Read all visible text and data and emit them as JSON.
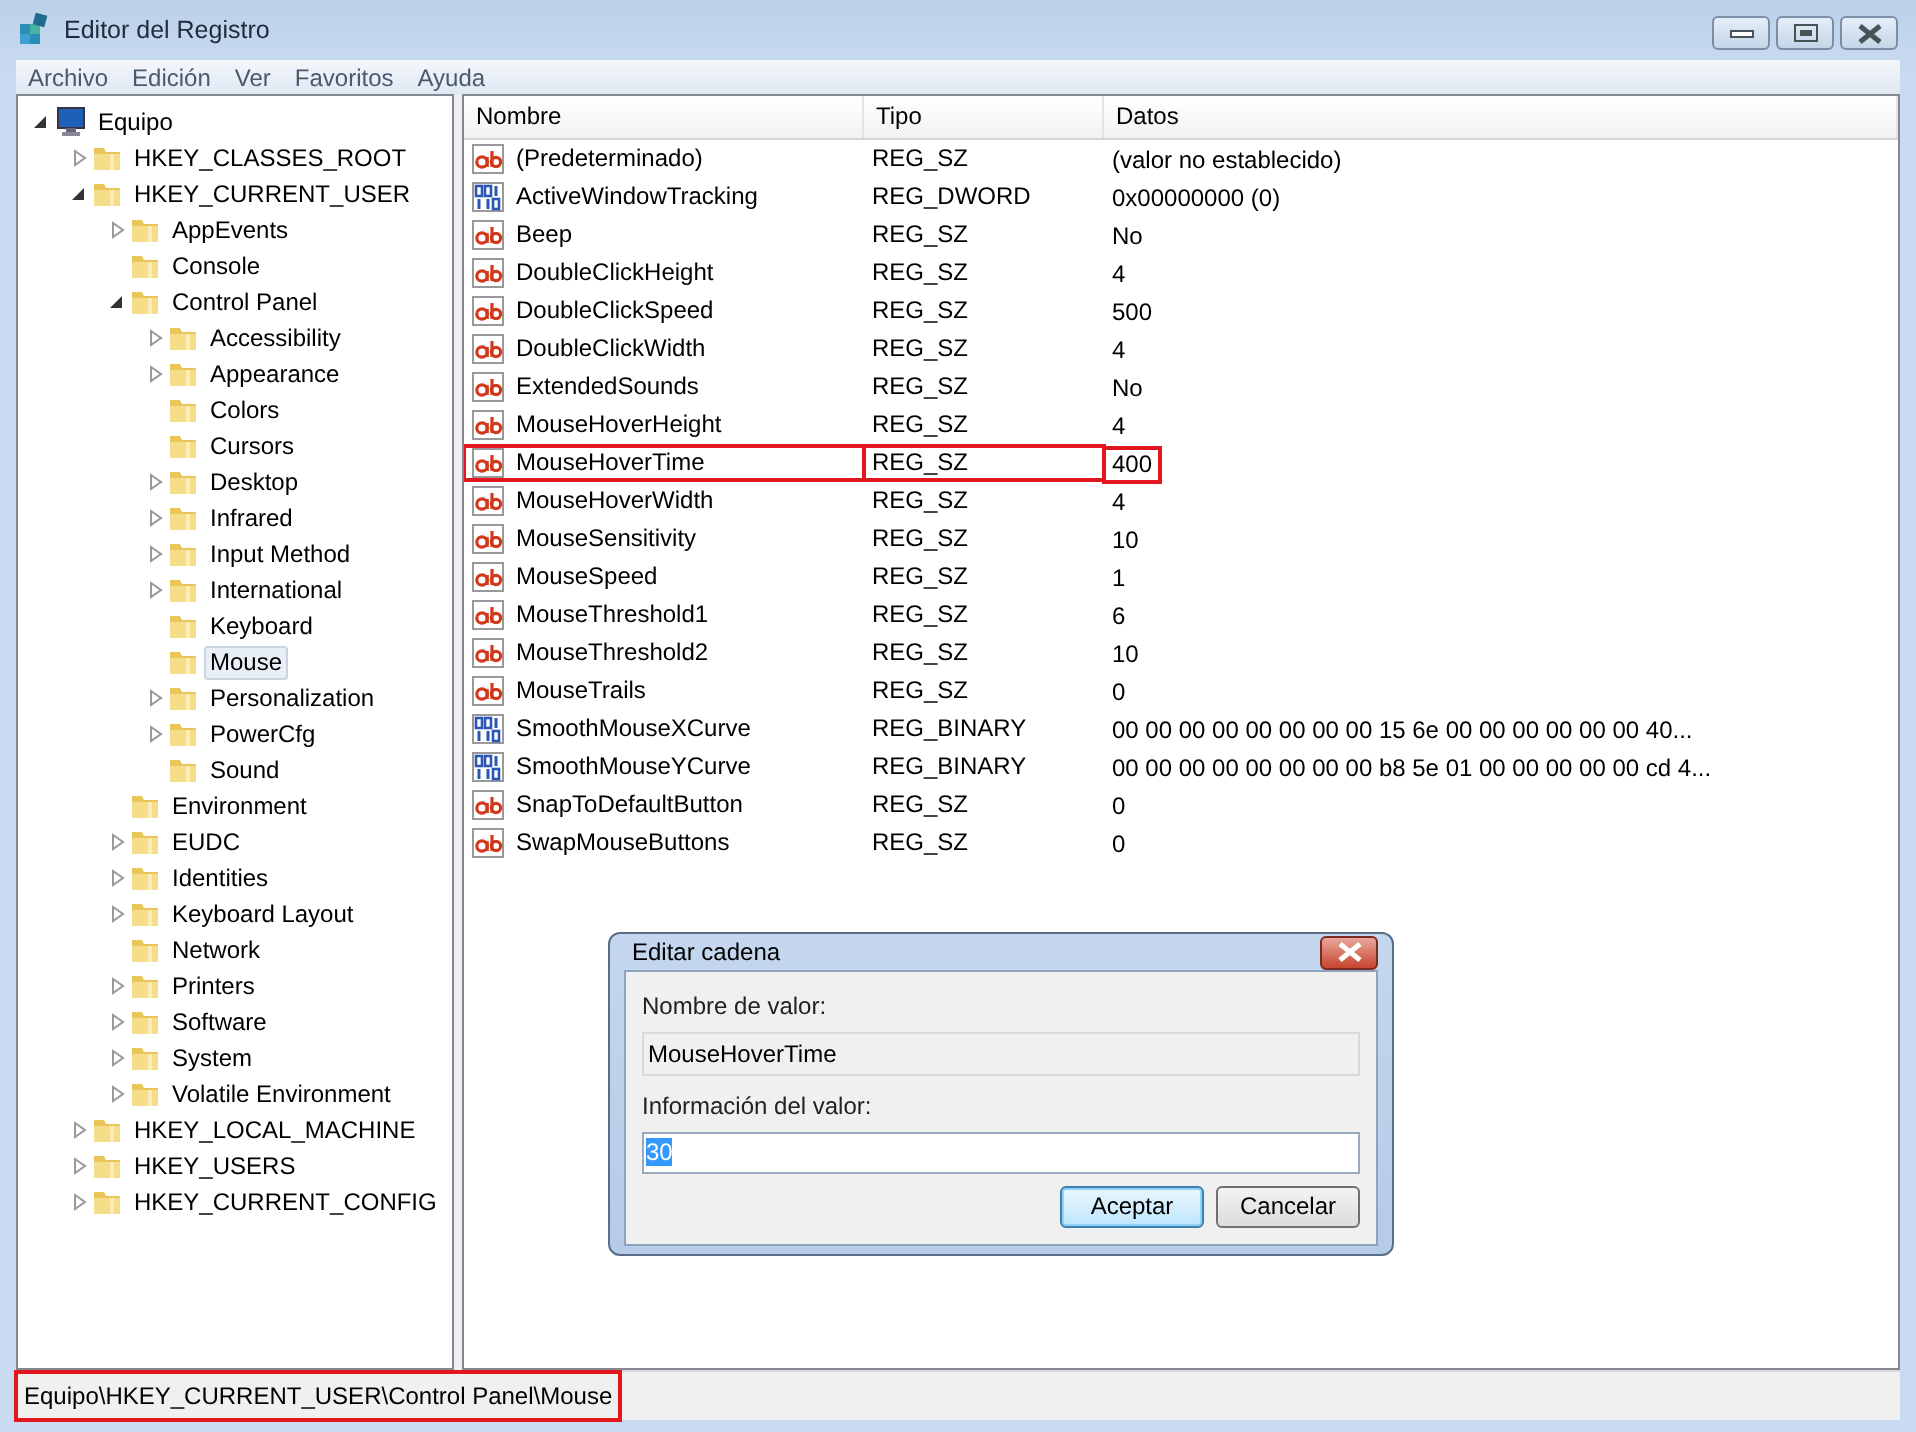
{
  "window": {
    "title": "Editor del Registro"
  },
  "menu": [
    "Archivo",
    "Edición",
    "Ver",
    "Favoritos",
    "Ayuda"
  ],
  "tree": [
    {
      "label": "Equipo",
      "kind": "computer",
      "expanded": true,
      "selected": false,
      "children": [
        {
          "label": "HKEY_CLASSES_ROOT",
          "kind": "branch",
          "expanded": false,
          "selected": false
        },
        {
          "label": "HKEY_CURRENT_USER",
          "kind": "branch",
          "expanded": true,
          "selected": false,
          "children": [
            {
              "label": "AppEvents",
              "kind": "branch",
              "expanded": false,
              "selected": false
            },
            {
              "label": "Console",
              "kind": "leaf",
              "selected": false
            },
            {
              "label": "Control Panel",
              "kind": "branch",
              "expanded": true,
              "selected": false,
              "children": [
                {
                  "label": "Accessibility",
                  "kind": "branch",
                  "expanded": false,
                  "selected": false
                },
                {
                  "label": "Appearance",
                  "kind": "branch",
                  "expanded": false,
                  "selected": false
                },
                {
                  "label": "Colors",
                  "kind": "leaf",
                  "selected": false
                },
                {
                  "label": "Cursors",
                  "kind": "leaf",
                  "selected": false
                },
                {
                  "label": "Desktop",
                  "kind": "branch",
                  "expanded": false,
                  "selected": false
                },
                {
                  "label": "Infrared",
                  "kind": "branch",
                  "expanded": false,
                  "selected": false
                },
                {
                  "label": "Input Method",
                  "kind": "branch",
                  "expanded": false,
                  "selected": false
                },
                {
                  "label": "International",
                  "kind": "branch",
                  "expanded": false,
                  "selected": false
                },
                {
                  "label": "Keyboard",
                  "kind": "leaf",
                  "selected": false
                },
                {
                  "label": "Mouse",
                  "kind": "leaf",
                  "selected": true
                },
                {
                  "label": "Personalization",
                  "kind": "branch",
                  "expanded": false,
                  "selected": false
                },
                {
                  "label": "PowerCfg",
                  "kind": "branch",
                  "expanded": false,
                  "selected": false
                },
                {
                  "label": "Sound",
                  "kind": "leaf",
                  "selected": false
                }
              ]
            },
            {
              "label": "Environment",
              "kind": "leaf",
              "selected": false
            },
            {
              "label": "EUDC",
              "kind": "branch",
              "expanded": false,
              "selected": false
            },
            {
              "label": "Identities",
              "kind": "branch",
              "expanded": false,
              "selected": false
            },
            {
              "label": "Keyboard Layout",
              "kind": "branch",
              "expanded": false,
              "selected": false
            },
            {
              "label": "Network",
              "kind": "leaf",
              "selected": false
            },
            {
              "label": "Printers",
              "kind": "branch",
              "expanded": false,
              "selected": false
            },
            {
              "label": "Software",
              "kind": "branch",
              "expanded": false,
              "selected": false
            },
            {
              "label": "System",
              "kind": "branch",
              "expanded": false,
              "selected": false
            },
            {
              "label": "Volatile Environment",
              "kind": "branch",
              "expanded": false,
              "selected": false
            }
          ]
        },
        {
          "label": "HKEY_LOCAL_MACHINE",
          "kind": "branch",
          "expanded": false,
          "selected": false
        },
        {
          "label": "HKEY_USERS",
          "kind": "branch",
          "expanded": false,
          "selected": false
        },
        {
          "label": "HKEY_CURRENT_CONFIG",
          "kind": "branch",
          "expanded": false,
          "selected": false
        }
      ]
    }
  ],
  "table": {
    "columns": [
      "Nombre",
      "Tipo",
      "Datos"
    ],
    "rows": [
      {
        "kind": "string",
        "name": "(Predeterminado)",
        "type": "REG_SZ",
        "data": "(valor no establecido)",
        "highlighted": false
      },
      {
        "kind": "binary",
        "name": "ActiveWindowTracking",
        "type": "REG_DWORD",
        "data": "0x00000000 (0)",
        "highlighted": false
      },
      {
        "kind": "string",
        "name": "Beep",
        "type": "REG_SZ",
        "data": "No",
        "highlighted": false
      },
      {
        "kind": "string",
        "name": "DoubleClickHeight",
        "type": "REG_SZ",
        "data": "4",
        "highlighted": false
      },
      {
        "kind": "string",
        "name": "DoubleClickSpeed",
        "type": "REG_SZ",
        "data": "500",
        "highlighted": false
      },
      {
        "kind": "string",
        "name": "DoubleClickWidth",
        "type": "REG_SZ",
        "data": "4",
        "highlighted": false
      },
      {
        "kind": "string",
        "name": "ExtendedSounds",
        "type": "REG_SZ",
        "data": "No",
        "highlighted": false
      },
      {
        "kind": "string",
        "name": "MouseHoverHeight",
        "type": "REG_SZ",
        "data": "4",
        "highlighted": false
      },
      {
        "kind": "string",
        "name": "MouseHoverTime",
        "type": "REG_SZ",
        "data": "400",
        "highlighted": true
      },
      {
        "kind": "string",
        "name": "MouseHoverWidth",
        "type": "REG_SZ",
        "data": "4",
        "highlighted": false
      },
      {
        "kind": "string",
        "name": "MouseSensitivity",
        "type": "REG_SZ",
        "data": "10",
        "highlighted": false
      },
      {
        "kind": "string",
        "name": "MouseSpeed",
        "type": "REG_SZ",
        "data": "1",
        "highlighted": false
      },
      {
        "kind": "string",
        "name": "MouseThreshold1",
        "type": "REG_SZ",
        "data": "6",
        "highlighted": false
      },
      {
        "kind": "string",
        "name": "MouseThreshold2",
        "type": "REG_SZ",
        "data": "10",
        "highlighted": false
      },
      {
        "kind": "string",
        "name": "MouseTrails",
        "type": "REG_SZ",
        "data": "0",
        "highlighted": false
      },
      {
        "kind": "binary",
        "name": "SmoothMouseXCurve",
        "type": "REG_BINARY",
        "data": "00 00 00 00 00 00 00 00 15 6e 00 00 00 00 00 00 40...",
        "highlighted": false
      },
      {
        "kind": "binary",
        "name": "SmoothMouseYCurve",
        "type": "REG_BINARY",
        "data": "00 00 00 00 00 00 00 00 b8 5e 01 00 00 00 00 00 cd 4...",
        "highlighted": false
      },
      {
        "kind": "string",
        "name": "SnapToDefaultButton",
        "type": "REG_SZ",
        "data": "0",
        "highlighted": false
      },
      {
        "kind": "string",
        "name": "SwapMouseButtons",
        "type": "REG_SZ",
        "data": "0",
        "highlighted": false
      }
    ]
  },
  "dialog": {
    "title": "Editar cadena",
    "name_label": "Nombre de valor:",
    "name_value": "MouseHoverTime",
    "data_label": "Información del valor:",
    "data_value": "30",
    "data_selected": true,
    "buttons": [
      {
        "label": "Aceptar",
        "default": true
      },
      {
        "label": "Cancelar",
        "default": false
      }
    ]
  },
  "status_bar": {
    "path": "Equipo\\HKEY_CURRENT_USER\\Control Panel\\Mouse",
    "highlighted": true
  }
}
